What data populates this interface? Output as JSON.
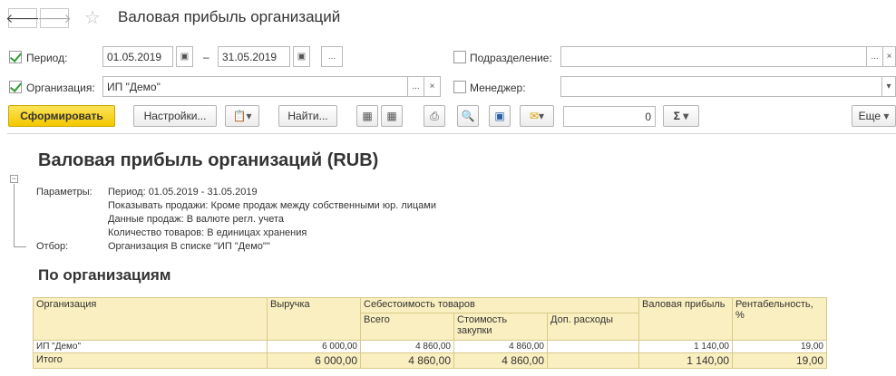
{
  "window": {
    "title": "Валовая прибыль организаций"
  },
  "icons": {
    "back": "arrow-left-icon",
    "forward": "arrow-right-icon",
    "favorite": "star-icon"
  },
  "filters": {
    "period_label": "Период:",
    "period_from": "01.05.2019",
    "period_dash": "–",
    "period_to": "31.05.2019",
    "period_more": "...",
    "organization_label": "Организация:",
    "organization_value": "ИП \"Демо\"",
    "subdivision_label": "Подразделение:",
    "manager_label": "Менеджер:",
    "ellipsis": "...",
    "clear": "×"
  },
  "toolbar": {
    "generate": "Сформировать",
    "settings": "Настройки...",
    "find": "Найти...",
    "sum_value": "0",
    "sigma": "Σ",
    "more": "Еще"
  },
  "report": {
    "title": "Валовая прибыль организаций (RUB)",
    "params_label": "Параметры:",
    "params": [
      "Период: 01.05.2019 - 31.05.2019",
      "Показывать продажи: Кроме продаж между собственными юр. лицами",
      "Данные продаж: В валюте регл. учета",
      "Количество товаров: В единицах хранения"
    ],
    "filter_label": "Отбор:",
    "filter_value": "Организация В списке \"ИП \"Демо\"\"",
    "section": "По организациям",
    "table": {
      "h_org": "Организация",
      "h_revenue": "Выручка",
      "h_cost": "Себестоимость товаров",
      "h_total": "Всего",
      "h_purchase": "Стоимость закупки",
      "h_extra": "Доп. расходы",
      "h_gross": "Валовая прибыль",
      "h_profitability": "Рентабельность, %",
      "row": {
        "org": "ИП \"Демо\"",
        "revenue": "6 000,00",
        "total": "4 860,00",
        "purchase": "4 860,00",
        "extra": "",
        "gross": "1 140,00",
        "profitability": "19,00"
      },
      "totals": {
        "label": "Итого",
        "revenue": "6 000,00",
        "total": "4 860,00",
        "purchase": "4 860,00",
        "extra": "",
        "gross": "1 140,00",
        "profitability": "19,00"
      }
    }
  }
}
